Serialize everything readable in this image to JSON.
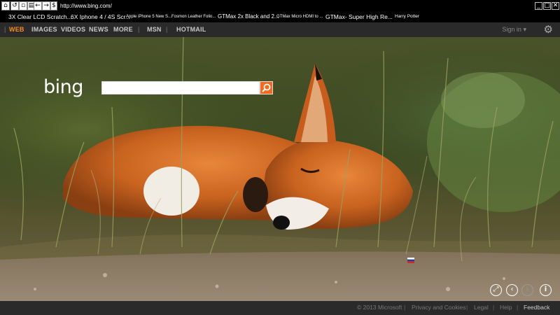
{
  "browser": {
    "url": "http://www.bing.com/",
    "toolbar_icons": [
      "home-icon",
      "refresh-icon",
      "page-icon",
      "folder-icon",
      "back-icon",
      "forward-icon",
      "dollar-icon"
    ],
    "window_buttons": {
      "minimize": "_",
      "maximize": "□",
      "close": "✕"
    },
    "bookmarks": [
      "3X Clear LCD Scratch...",
      "6X Iphone 4 / 4S Scr...",
      "Apple iPhone 5 New S...",
      "Fosmon Leather Folio...",
      "GTMax 2x Black and 2...",
      "GTMax Micro HDMI to ...",
      "GTMax- Super High Re...",
      "Harry Potter"
    ]
  },
  "header": {
    "nav": [
      {
        "label": "WEB",
        "active": true
      },
      {
        "label": "IMAGES"
      },
      {
        "label": "VIDEOS"
      },
      {
        "label": "NEWS"
      },
      {
        "label": "MORE"
      },
      {
        "label": "MSN"
      },
      {
        "label": "HOTMAIL"
      }
    ],
    "separator": "|",
    "signin": "Sign in",
    "signin_caret": "▾",
    "gear": "⚙"
  },
  "search": {
    "logo": "bing",
    "value": "",
    "button_icon": "search-icon"
  },
  "controls": {
    "expand": "⤢",
    "prev": "‹",
    "next": "›",
    "info": "i"
  },
  "footer": {
    "copyright": "© 2013 Microsoft",
    "links": [
      "Privacy and Cookies",
      "Legal",
      "Help",
      "Feedback"
    ],
    "separator": "|"
  },
  "colors": {
    "accent": "#ff8a1e",
    "search_button": "#f26a1f",
    "bar": "#2a2a2a"
  }
}
